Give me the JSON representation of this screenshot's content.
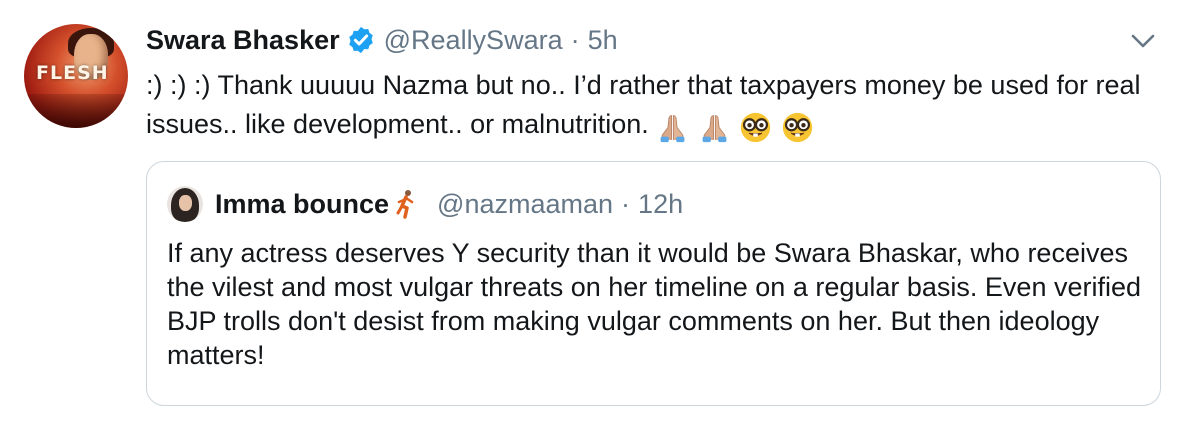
{
  "tweet": {
    "author": {
      "display_name": "Swara Bhasker",
      "handle": "@ReallySwara",
      "avatar_text": "FLESH",
      "verified": true
    },
    "separator": "·",
    "time": "5h",
    "text": ":) :) :) Thank uuuuu Nazma but no.. I’d rather that taxpayers money be used for real issues.. like development.. or malnutrition.",
    "emojis": [
      "folded-hands",
      "folded-hands",
      "nerd-face",
      "nerd-face"
    ],
    "menu_icon": "chevron-down-icon"
  },
  "quoted_tweet": {
    "author": {
      "display_name": "Imma bounce",
      "handle": "@nazmaaman",
      "name_emoji": "person-running"
    },
    "separator": "·",
    "time": "12h",
    "text": "If any actress deserves Y security than it would be Swara Bhaskar, who receives the vilest and most vulgar threats on her timeline on a regular basis. Even verified BJP trolls don't desist from making vulgar comments on her. But then ideology matters!"
  },
  "colors": {
    "text_primary": "#14171a",
    "text_secondary": "#657786",
    "verified_blue": "#1da1f2",
    "border": "#ccd6dd"
  }
}
